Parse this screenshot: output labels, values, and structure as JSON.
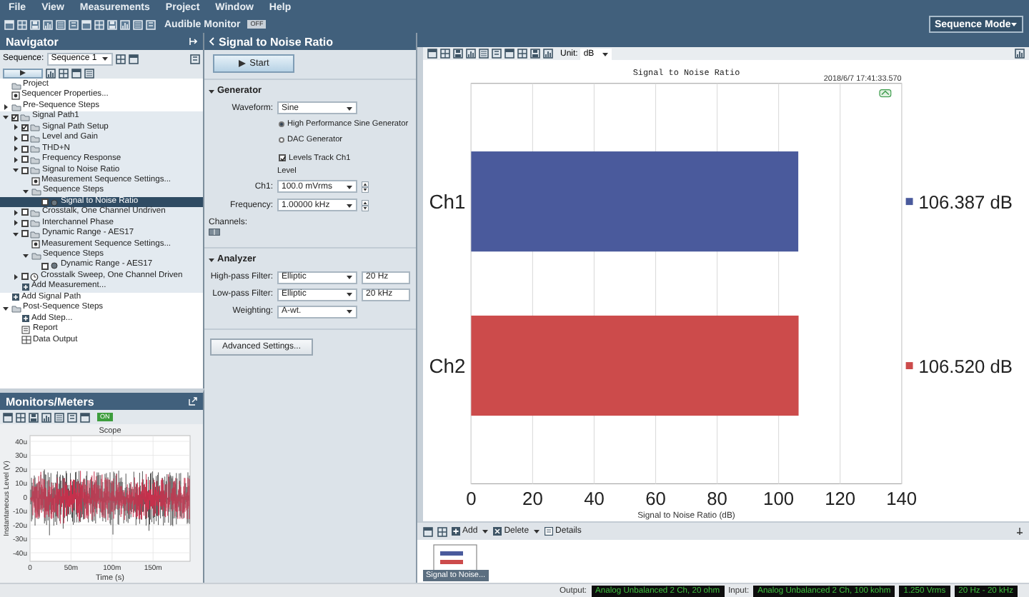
{
  "menu": [
    "File",
    "View",
    "Measurements",
    "Project",
    "Window",
    "Help"
  ],
  "toolbar": {
    "audible_monitor": "Audible Monitor",
    "monitor_state": "OFF",
    "mode": "Sequence Mode"
  },
  "navigator": {
    "title": "Navigator",
    "sequence_label": "Sequence:",
    "sequence": "Sequence 1",
    "tree": [
      {
        "label": "Project",
        "kind": "project",
        "selected": false
      },
      {
        "label": "Sequencer Properties...",
        "kind": "settings",
        "selected": false
      },
      {
        "label": "Pre-Sequence Steps",
        "kind": "folder",
        "expanded": false,
        "selected": false
      },
      {
        "label": "Signal Path1",
        "kind": "path",
        "expanded": true,
        "checked": true,
        "selected": false,
        "children": [
          {
            "label": "Signal Path Setup",
            "kind": "folder",
            "expanded": false,
            "checked": true,
            "selected": false
          },
          {
            "label": "Level and Gain",
            "kind": "folder",
            "expanded": false,
            "checked": false,
            "selected": false
          },
          {
            "label": "THD+N",
            "kind": "folder",
            "expanded": false,
            "checked": false,
            "selected": false
          },
          {
            "label": "Frequency Response",
            "kind": "folder",
            "expanded": false,
            "checked": false,
            "selected": false
          },
          {
            "label": "Signal to Noise Ratio",
            "kind": "folder",
            "expanded": true,
            "checked": false,
            "selected": false,
            "children": [
              {
                "label": "Measurement Sequence Settings...",
                "kind": "settings",
                "selected": false
              },
              {
                "label": "Sequence Steps",
                "kind": "steps",
                "expanded": true,
                "selected": false,
                "children": [
                  {
                    "label": "Signal to Noise Ratio",
                    "kind": "step",
                    "checked": false,
                    "selected": true
                  }
                ]
              }
            ]
          },
          {
            "label": "Crosstalk, One Channel Undriven",
            "kind": "folder",
            "expanded": false,
            "checked": false,
            "selected": false
          },
          {
            "label": "Interchannel Phase",
            "kind": "folder",
            "expanded": false,
            "checked": false,
            "selected": false
          },
          {
            "label": "Dynamic Range - AES17",
            "kind": "folder",
            "expanded": true,
            "checked": false,
            "selected": false,
            "children": [
              {
                "label": "Measurement Sequence Settings...",
                "kind": "settings",
                "selected": false
              },
              {
                "label": "Sequence Steps",
                "kind": "steps",
                "expanded": true,
                "selected": false,
                "children": [
                  {
                    "label": "Dynamic Range - AES17",
                    "kind": "step",
                    "checked": false,
                    "selected": false
                  }
                ]
              }
            ]
          },
          {
            "label": "Crosstalk Sweep, One Channel Driven",
            "kind": "sweep",
            "expanded": false,
            "checked": false,
            "selected": false
          },
          {
            "label": "Add Measurement...",
            "kind": "add",
            "selected": false
          }
        ]
      },
      {
        "label": "Add Signal Path",
        "kind": "add",
        "selected": false
      },
      {
        "label": "Post-Sequence Steps",
        "kind": "folder",
        "expanded": true,
        "selected": false,
        "children": [
          {
            "label": "Add Step...",
            "kind": "add",
            "selected": false
          },
          {
            "label": "Report",
            "kind": "report",
            "selected": false
          },
          {
            "label": "Data Output",
            "kind": "output",
            "selected": false
          }
        ]
      }
    ]
  },
  "monitors": {
    "title": "Monitors/Meters",
    "state": "ON",
    "scope": {
      "title": "Scope",
      "ylabel": "Instantaneous Level (V)",
      "xlabel": "Time (s)",
      "yticks": [
        "40u",
        "30u",
        "20u",
        "10u",
        "0",
        "-10u",
        "-20u",
        "-30u",
        "-40u"
      ],
      "xticks": [
        "0",
        "50m",
        "100m",
        "150m"
      ]
    }
  },
  "measurement": {
    "title": "Signal to Noise Ratio",
    "start": "Start",
    "generator": {
      "title": "Generator",
      "waveform_label": "Waveform:",
      "waveform": "Sine",
      "options": [
        {
          "label": "High Performance Sine Generator",
          "selected": true
        },
        {
          "label": "DAC Generator",
          "selected": false
        }
      ],
      "levels_track": {
        "label": "Levels Track Ch1",
        "checked": true
      },
      "level_heading": "Level",
      "ch1_label": "Ch1:",
      "ch1": "100.0 mVrms",
      "frequency_label": "Frequency:",
      "frequency": "1.00000 kHz"
    },
    "channels_label": "Channels:",
    "analyzer": {
      "title": "Analyzer",
      "rows": [
        {
          "label": "High-pass Filter:",
          "value": "Elliptic",
          "extra": "20 Hz"
        },
        {
          "label": "Low-pass Filter:",
          "value": "Elliptic",
          "extra": "20 kHz"
        },
        {
          "label": "Weighting:",
          "value": "A-wt."
        }
      ]
    },
    "advanced": "Advanced Settings..."
  },
  "results": {
    "unit_label": "Unit:",
    "unit": "dB",
    "timestamp": "2018/6/7 17:41:33.570",
    "chart_data": {
      "type": "bar",
      "orientation": "horizontal",
      "grid": true,
      "title": "Signal to Noise Ratio",
      "xlabel": "Signal to Noise Ratio (dB)",
      "categories": [
        "Ch1",
        "Ch2"
      ],
      "series": [
        {
          "color": "#4a5a9c",
          "values": [
            106.4,
            null
          ]
        },
        {
          "color": "#cc4b4b",
          "values": [
            null,
            106.5
          ]
        }
      ],
      "xlim": [
        0,
        140
      ],
      "xticks": [
        0,
        20,
        40,
        60,
        80,
        100,
        120,
        140
      ],
      "value_labels": [
        "106.387 dB",
        "106.520 dB"
      ]
    },
    "actions": [
      "Add",
      "Delete",
      "Details"
    ],
    "thumbnail": "Signal to Noise..."
  },
  "status": {
    "output_label": "Output:",
    "output": "Analog Unbalanced 2 Ch, 20 ohm",
    "input_label": "Input:",
    "input": "Analog Unbalanced 2 Ch, 100 kohm",
    "level": "1.250 Vrms",
    "bandwidth": "20 Hz - 20 kHz"
  }
}
